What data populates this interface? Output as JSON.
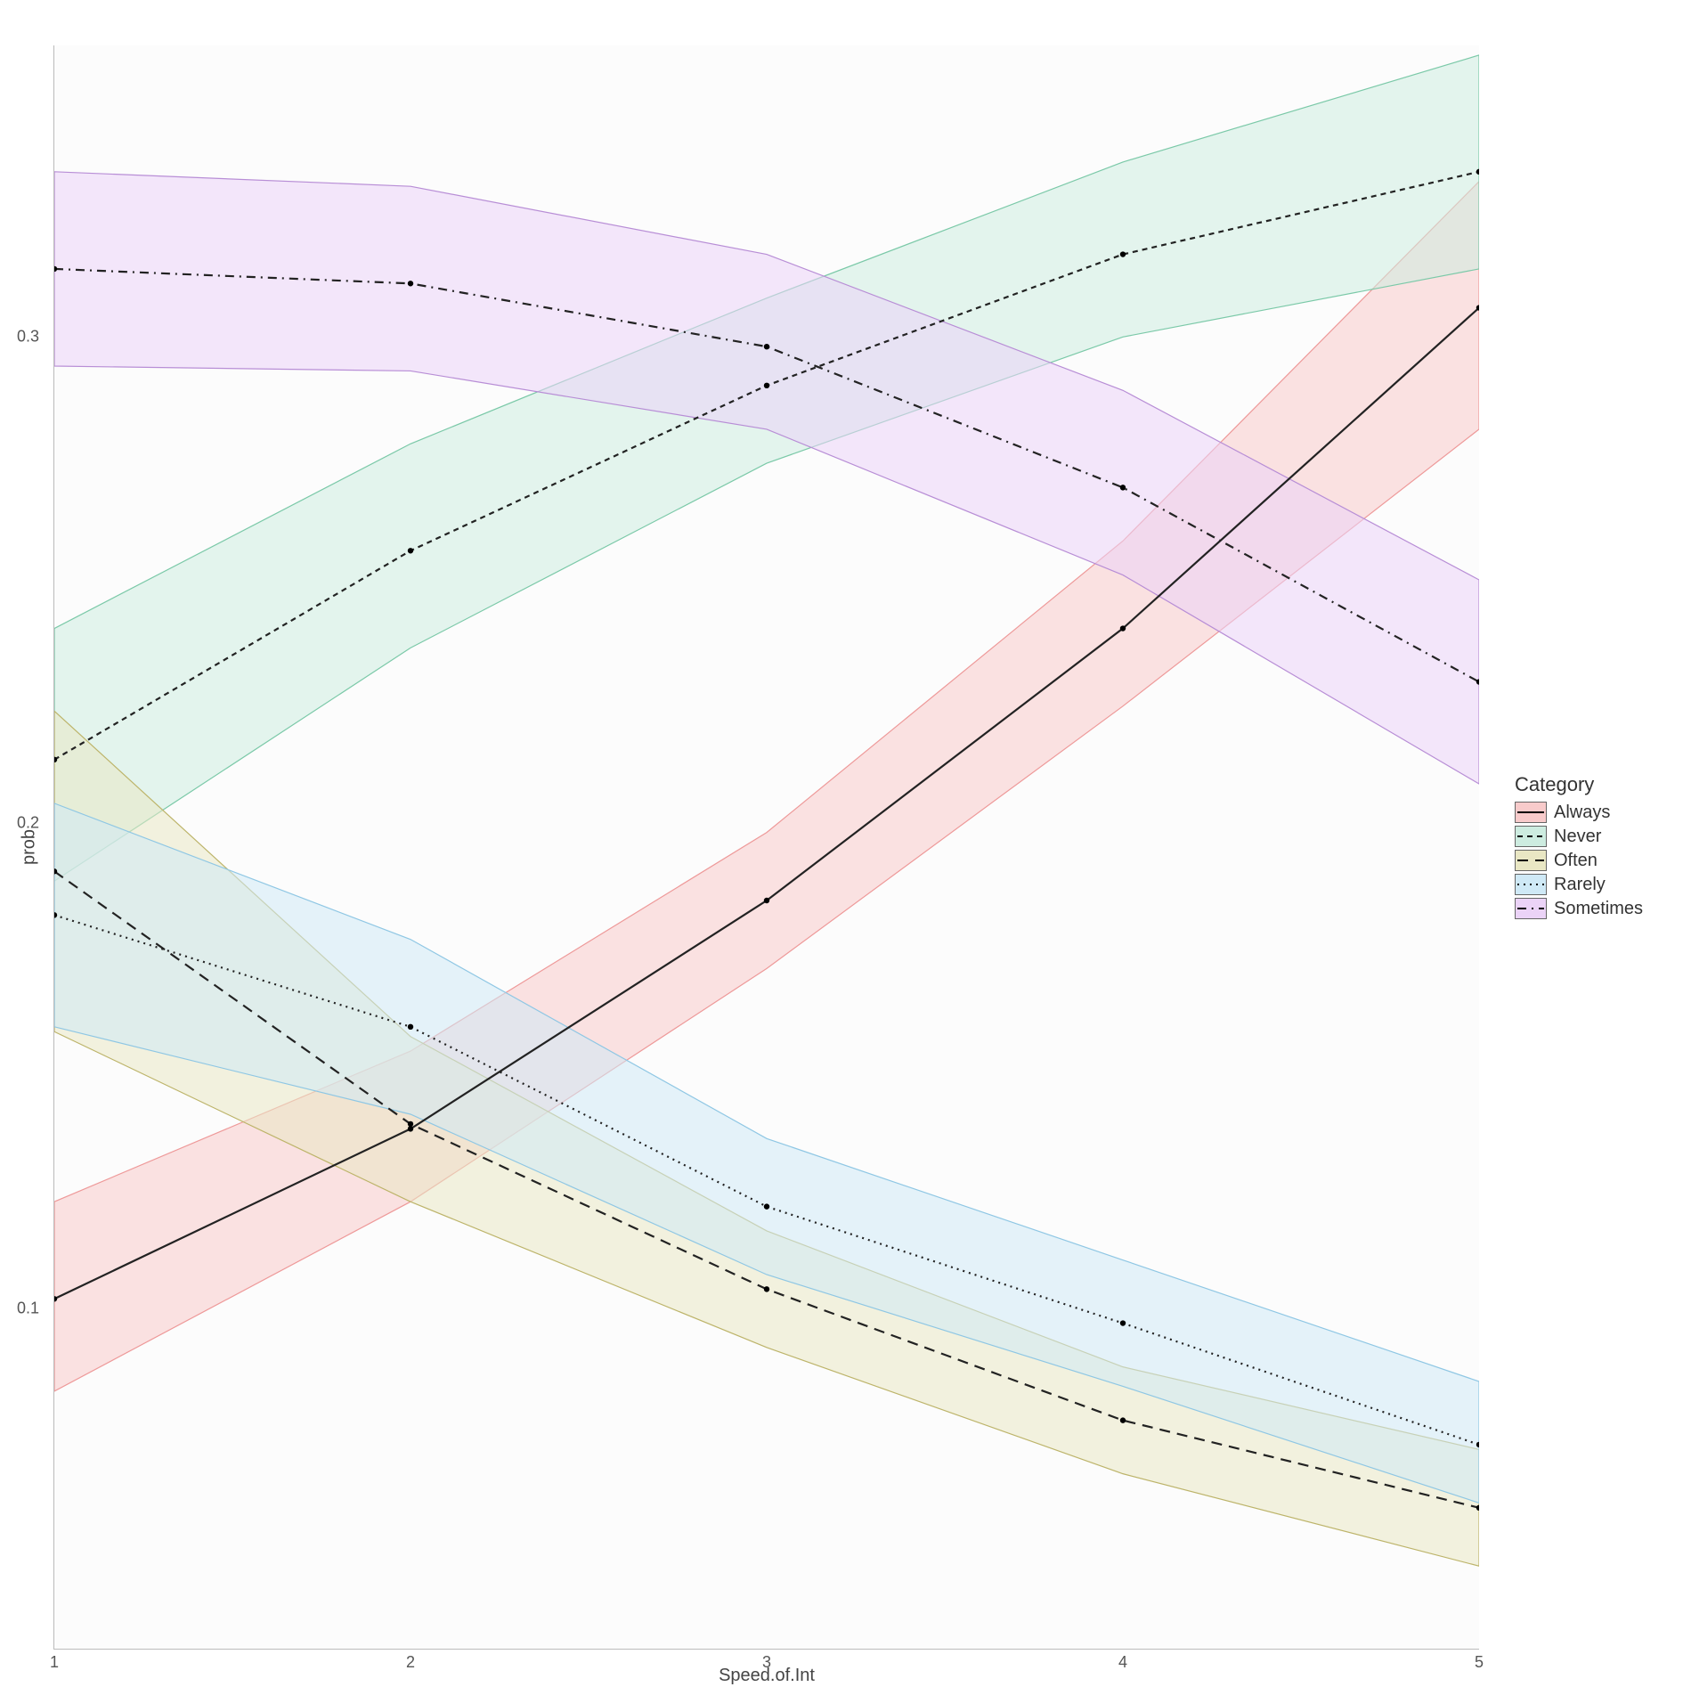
{
  "chart_data": {
    "type": "line",
    "xlabel": "Speed.of.Int",
    "ylabel": "prob",
    "x": [
      1,
      2,
      3,
      4,
      5
    ],
    "xlim": [
      1,
      5
    ],
    "ylim": [
      0.03,
      0.36
    ],
    "yticks": [
      0.1,
      0.2,
      0.3
    ],
    "legend_title": "Category",
    "series": [
      {
        "name": "Always",
        "color": "#F8CBCB",
        "edge": "#E99",
        "dash": "solid",
        "mean": [
          0.102,
          0.137,
          0.184,
          0.24,
          0.306
        ],
        "lo": [
          0.083,
          0.122,
          0.17,
          0.224,
          0.281
        ],
        "hi": [
          0.122,
          0.153,
          0.198,
          0.258,
          0.332
        ]
      },
      {
        "name": "Never",
        "color": "#CDECE0",
        "edge": "#7BC9A8",
        "dash": "6,5",
        "mean": [
          0.213,
          0.256,
          0.29,
          0.317,
          0.334
        ],
        "lo": [
          0.188,
          0.236,
          0.274,
          0.3,
          0.314
        ],
        "hi": [
          0.24,
          0.278,
          0.308,
          0.336,
          0.358
        ]
      },
      {
        "name": "Often",
        "color": "#E9E7C4",
        "edge": "#BDB46A",
        "dash": "12,8",
        "mean": [
          0.19,
          0.138,
          0.104,
          0.077,
          0.059
        ],
        "lo": [
          0.157,
          0.122,
          0.092,
          0.066,
          0.047
        ],
        "hi": [
          0.223,
          0.156,
          0.116,
          0.088,
          0.071
        ]
      },
      {
        "name": "Rarely",
        "color": "#CFE9F6",
        "edge": "#8FC7E4",
        "dash": "2,5",
        "mean": [
          0.181,
          0.158,
          0.121,
          0.097,
          0.072
        ],
        "lo": [
          0.158,
          0.14,
          0.107,
          0.084,
          0.06
        ],
        "hi": [
          0.204,
          0.176,
          0.135,
          0.11,
          0.085
        ]
      },
      {
        "name": "Sometimes",
        "color": "#EBD3F7",
        "edge": "#B88ED6",
        "dash": "10,6,2,6",
        "mean": [
          0.314,
          0.311,
          0.298,
          0.269,
          0.229
        ],
        "lo": [
          0.294,
          0.293,
          0.281,
          0.251,
          0.208
        ],
        "hi": [
          0.334,
          0.331,
          0.317,
          0.289,
          0.25
        ]
      }
    ]
  }
}
